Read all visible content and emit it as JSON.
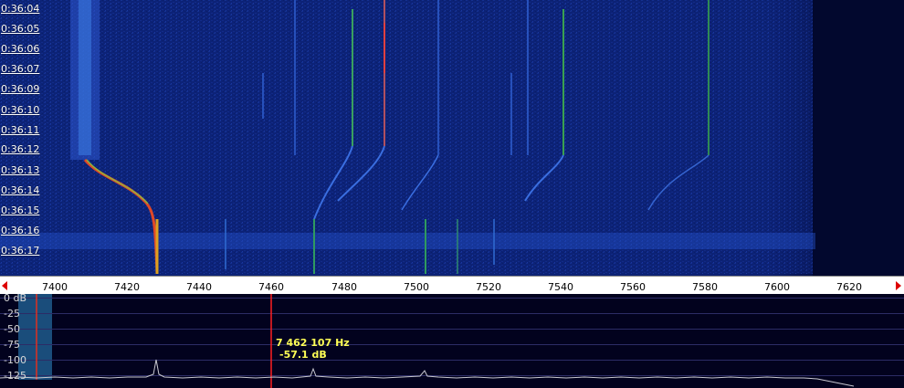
{
  "waterfall": {
    "time_labels": [
      "0:36:04",
      "0:36:05",
      "0:36:06",
      "0:36:07",
      "0:36:09",
      "0:36:10",
      "0:36:11",
      "0:36:12",
      "0:36:13",
      "0:36:14",
      "0:36:15",
      "0:36:16",
      "0:36:17"
    ]
  },
  "frequency_scale": {
    "labels": [
      "7400",
      "7420",
      "7440",
      "7460",
      "7480",
      "7500",
      "7520",
      "7540",
      "7560",
      "7580",
      "7600",
      "7620"
    ]
  },
  "spectrum": {
    "db_labels": [
      "0 dB",
      "-25",
      "-50",
      "-75",
      "-100",
      "-125"
    ],
    "cursor_readout": {
      "frequency": "7 462 107 Hz",
      "level": "-57.1 dB"
    }
  },
  "colors": {
    "waterfall_background": "#0b1e6e",
    "spectrum_background": "#02021e",
    "cursor": "#ff2020",
    "readout_text": "#ffff55",
    "scale_background": "#ffffff"
  }
}
